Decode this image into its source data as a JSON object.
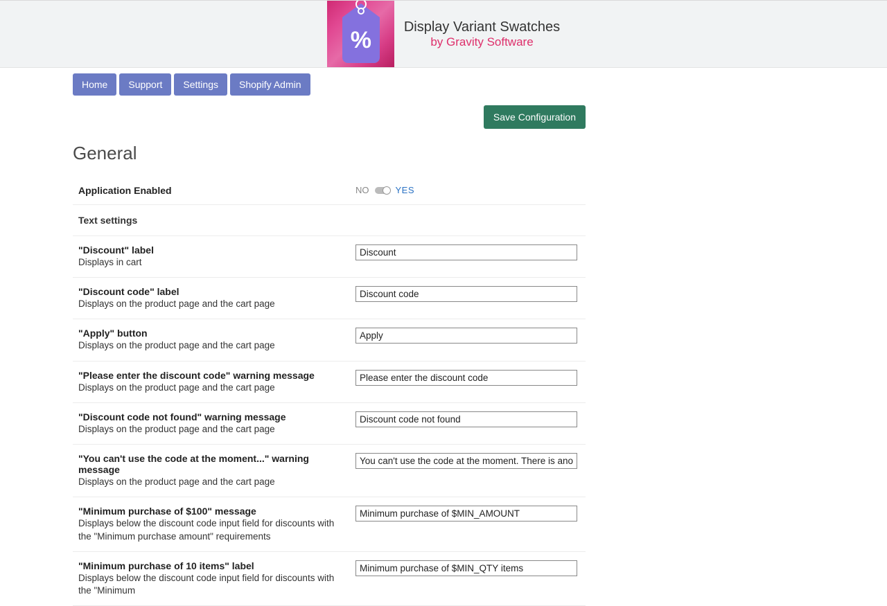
{
  "header": {
    "title": "Display Variant Swatches",
    "byline": "by Gravity Software",
    "tag_symbol": "%"
  },
  "nav": {
    "home": "Home",
    "support": "Support",
    "settings": "Settings",
    "shopify_admin": "Shopify Admin"
  },
  "actions": {
    "save": "Save Configuration"
  },
  "section_title": "General",
  "app_enabled": {
    "label": "Application Enabled",
    "no": "NO",
    "yes": "YES"
  },
  "text_settings_header": "Text settings",
  "fields": [
    {
      "title": "\"Discount\" label",
      "desc": "Displays in cart",
      "value": "Discount"
    },
    {
      "title": "\"Discount code\" label",
      "desc": "Displays on the product page and the cart page",
      "value": "Discount code"
    },
    {
      "title": "\"Apply\" button",
      "desc": "Displays on the product page and the cart page",
      "value": "Apply"
    },
    {
      "title": "\"Please enter the discount code\" warning message",
      "desc": "Displays on the product page and the cart page",
      "value": "Please enter the discount code"
    },
    {
      "title": "\"Discount code not found\" warning message",
      "desc": "Displays on the product page and the cart page",
      "value": "Discount code not found"
    },
    {
      "title": "\"You can't use the code at the moment...\" warning message",
      "desc": "Displays on the product page and the cart page",
      "value": "You can't use the code at the moment. There is another discount applied."
    },
    {
      "title": "\"Minimum purchase of $100\" message",
      "desc": "Displays below the discount code input field for discounts with the \"Minimum purchase amount\" requirements",
      "value": "Minimum purchase of $MIN_AMOUNT"
    },
    {
      "title": "\"Minimum purchase of 10 items\" label",
      "desc": "Displays below the discount code input field for discounts with the \"Minimum",
      "value": "Minimum purchase of $MIN_QTY items"
    }
  ]
}
